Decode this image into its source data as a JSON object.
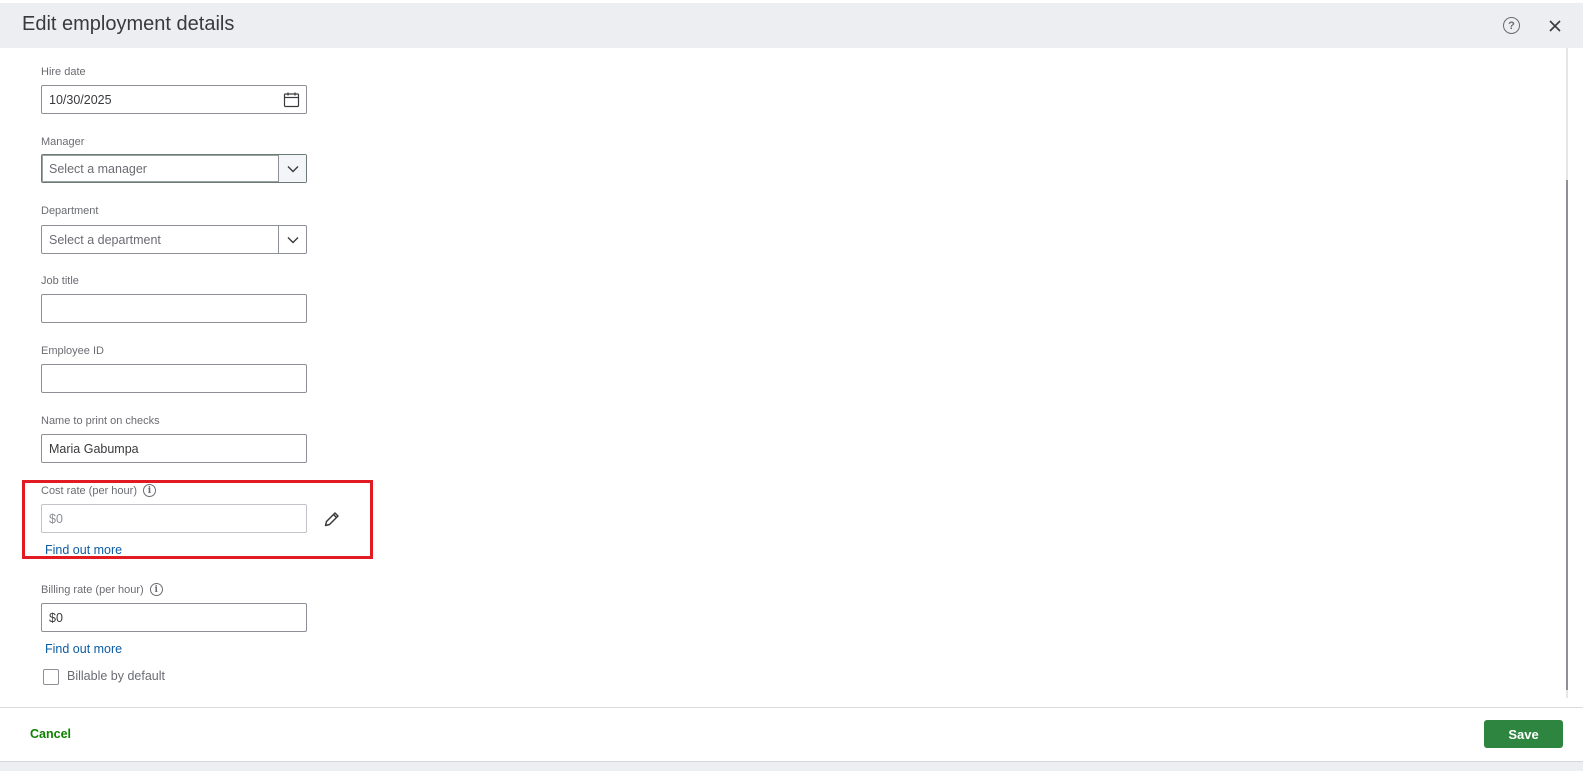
{
  "dialog": {
    "title": "Edit employment details",
    "help_icon": "question-circle-icon",
    "close_icon": "close-icon"
  },
  "form": {
    "hire_date": {
      "label": "Hire date",
      "value": "10/30/2025",
      "icon": "calendar-icon"
    },
    "manager": {
      "label": "Manager",
      "placeholder": "Select a manager"
    },
    "department": {
      "label": "Department",
      "placeholder": "Select a department"
    },
    "job_title": {
      "label": "Job title",
      "value": ""
    },
    "employee_id": {
      "label": "Employee ID",
      "value": ""
    },
    "name_on_checks": {
      "label": "Name to print on checks",
      "value": "Maria Gabumpa"
    },
    "cost_rate": {
      "label": "Cost rate (per hour)",
      "value": "$0",
      "link": "Find out more",
      "edit_icon": "pencil-icon"
    },
    "billing_rate": {
      "label": "Billing rate (per hour)",
      "value": "$0",
      "link": "Find out more"
    },
    "billable": {
      "label": "Billable by default",
      "checked": false
    }
  },
  "footer": {
    "cancel_label": "Cancel",
    "save_label": "Save"
  },
  "colors": {
    "highlight": "#e21b23",
    "primary_button": "#2e8540",
    "link": "#0d5ca4",
    "cancel": "#108000"
  }
}
